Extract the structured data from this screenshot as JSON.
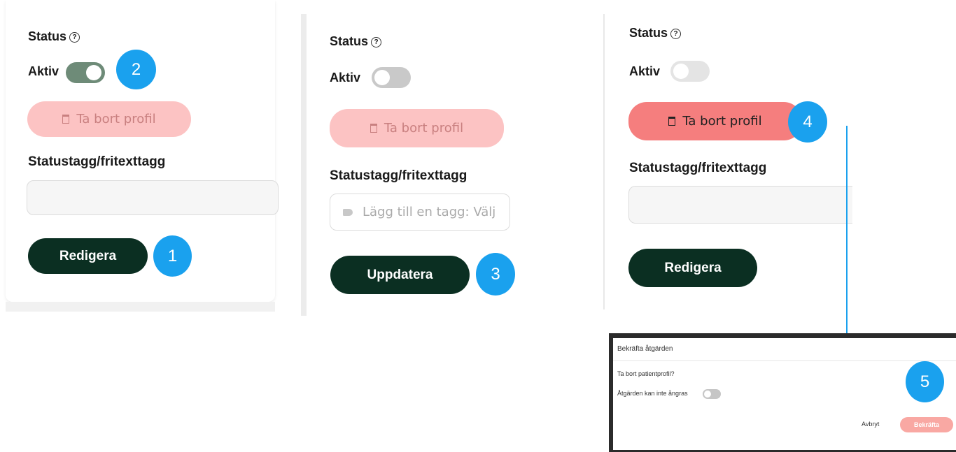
{
  "panels": [
    {
      "status_label": "Status",
      "help_icon": "question-circle-icon",
      "toggle_label": "Aktiv",
      "toggle_state": "on",
      "delete_label": "Ta bort profil",
      "delete_state": "disabled",
      "tag_label": "Statustagg/fritexttagg",
      "tag_input_value": "",
      "action_label": "Redigera",
      "action_badge": "1",
      "toggle_badge": "2"
    },
    {
      "status_label": "Status",
      "toggle_label": "Aktiv",
      "toggle_state": "off",
      "delete_label": "Ta bort profil",
      "delete_state": "disabled",
      "tag_label": "Statustagg/fritexttagg",
      "tag_input_placeholder": "Lägg till en tagg: Välj",
      "action_label": "Uppdatera",
      "action_badge": "3"
    },
    {
      "status_label": "Status",
      "toggle_label": "Aktiv",
      "toggle_state": "off",
      "delete_label": "Ta bort profil",
      "delete_state": "active",
      "tag_label": "Statustagg/fritexttagg",
      "tag_input_value": "",
      "action_label": "Redigera",
      "delete_badge": "4"
    }
  ],
  "dialog": {
    "title": "Bekräfta åtgärden",
    "question": "Ta bort patientprofil?",
    "irreversible_label": "Åtgärden kan inte ångras",
    "irreversible_toggle_state": "off",
    "cancel_label": "Avbryt",
    "confirm_label": "Bekräfta",
    "badge": "5"
  },
  "colors": {
    "dark_button": "#0b2f22",
    "badge": "#1aa1ee",
    "delete_disabled": "#fcc3c3",
    "delete_active": "#f57e7e",
    "toggle_on": "#6e8b78"
  }
}
